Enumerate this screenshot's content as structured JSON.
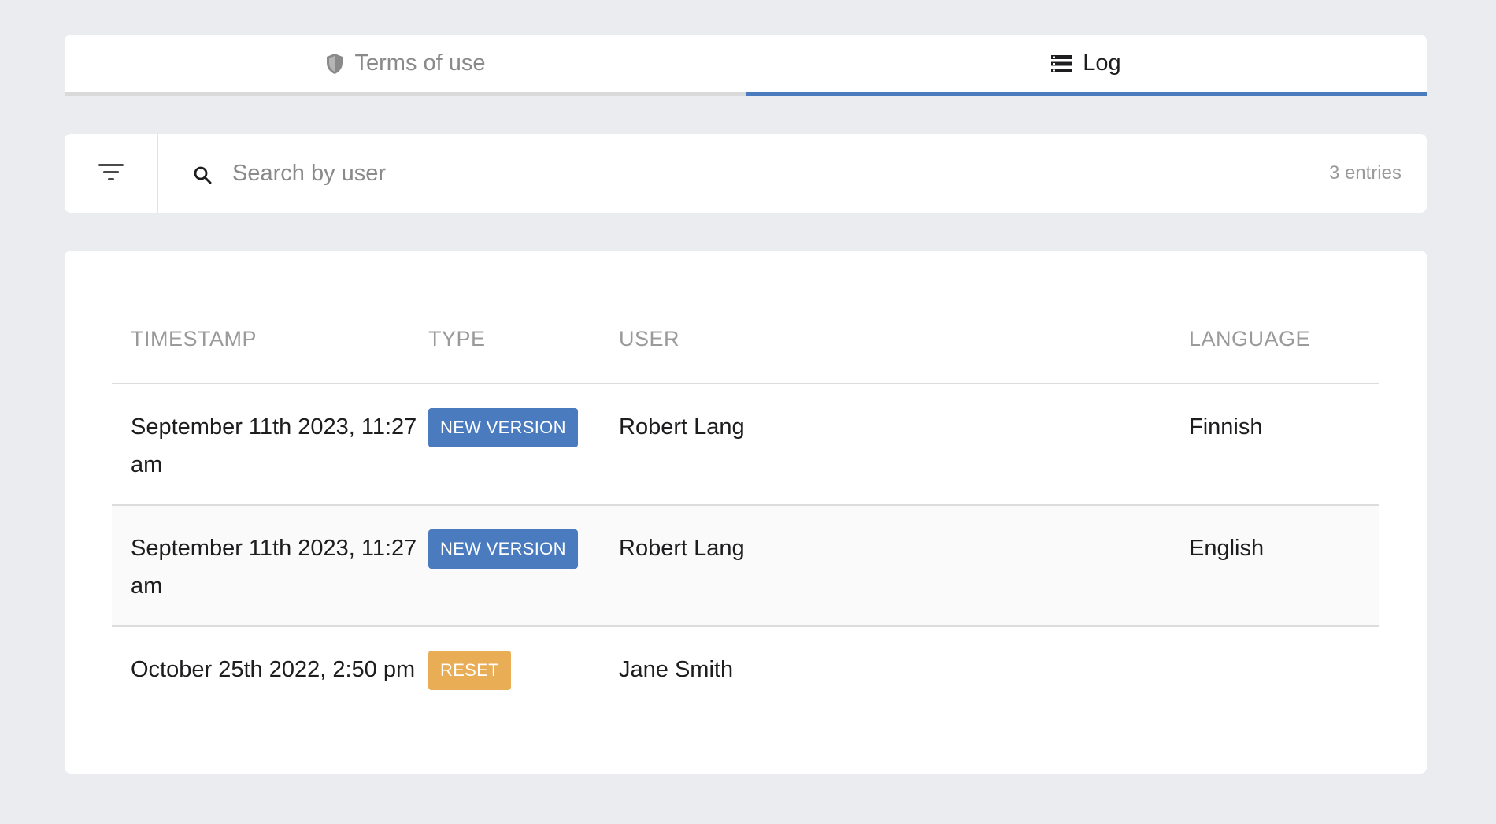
{
  "tabs": [
    {
      "label": "Terms of use",
      "icon": "shield-icon",
      "active": false
    },
    {
      "label": "Log",
      "icon": "list-icon",
      "active": true
    }
  ],
  "search": {
    "placeholder": "Search by user",
    "value": "",
    "entries_label": "3 entries"
  },
  "table": {
    "headers": {
      "timestamp": "TIMESTAMP",
      "type": "TYPE",
      "user": "USER",
      "language": "LANGUAGE"
    },
    "rows": [
      {
        "timestamp": "September 11th 2023, 11:27 am",
        "type": "NEW VERSION",
        "type_kind": "new",
        "user": "Robert Lang",
        "language": "Finnish"
      },
      {
        "timestamp": "September 11th 2023, 11:27 am",
        "type": "NEW VERSION",
        "type_kind": "new",
        "user": "Robert Lang",
        "language": "English"
      },
      {
        "timestamp": "October 25th 2022, 2:50 pm",
        "type": "RESET",
        "type_kind": "reset",
        "user": "Jane Smith",
        "language": ""
      }
    ]
  },
  "colors": {
    "accent": "#4a7bbf",
    "badge_new": "#4a7bbf",
    "badge_reset": "#e8ad55",
    "background": "#eaecef"
  }
}
